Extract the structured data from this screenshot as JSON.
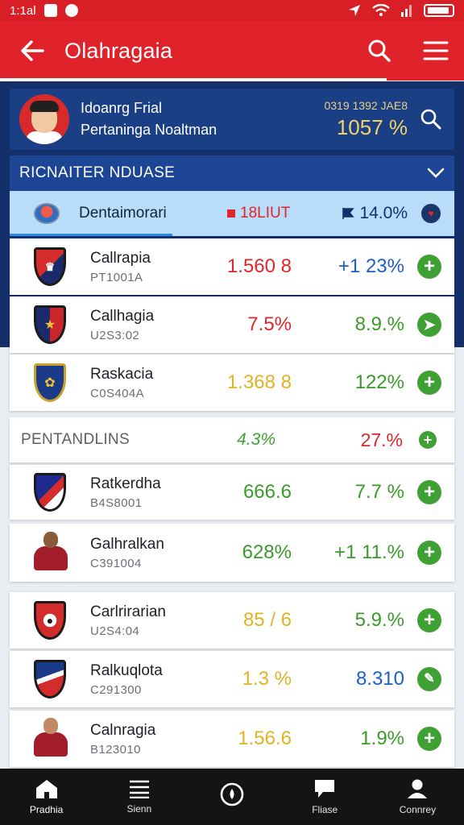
{
  "status_bar": {
    "time": "1:1al"
  },
  "app_bar": {
    "title": "Olahragaia"
  },
  "profile": {
    "name": "Idoanrg Frial",
    "subtitle": "Pertaninga Noaltman",
    "stat_label": "0319 1392 JAE8",
    "stat_value": "1057 %"
  },
  "section1": {
    "title": "RICNAITER NDUASE"
  },
  "highlight_row": {
    "label": "Dentaimorari",
    "value": "18LIUT",
    "percent": "14.0%"
  },
  "rows_top": [
    {
      "name": "Callrapia",
      "code": "PT1001A",
      "value": "1.560 8",
      "percent": "+1 23%",
      "value_color": "#e0262d",
      "percent_color": "#1f5fc4",
      "icon": "plus-icon"
    },
    {
      "name": "Callhagia",
      "code": "U2S3:02",
      "value": "7.5%",
      "percent": "8.9.%",
      "value_color": "#e0262d",
      "percent_color": "#3a9a2a",
      "icon": "arrow-icon"
    },
    {
      "name": "Raskacia",
      "code": "C0S404A",
      "value": "1.368 8",
      "percent": "122%",
      "value_color": "#dfb323",
      "percent_color": "#3a9a2a",
      "icon": "plus-icon"
    }
  ],
  "section2": {
    "title": "PENTANDLINS",
    "value": "4.3%",
    "percent": "27.%"
  },
  "rows_bottom": [
    {
      "name": "Ratkerdha",
      "code": "B4S8001",
      "value": "666.6",
      "percent": "7.7 %",
      "value_color": "#3a9a2a",
      "percent_color": "#3a9a2a",
      "icon": "plus-icon"
    },
    {
      "name": "Galhralkan",
      "code": "C391004",
      "value": "628%",
      "percent": "+1 11.%",
      "value_color": "#3a9a2a",
      "percent_color": "#3a9a2a",
      "icon": "plus-icon"
    },
    {
      "name": "Carlrirarian",
      "code": "U2S4:04",
      "value": "85 / 6",
      "percent": "5.9.%",
      "value_color": "#dfb323",
      "percent_color": "#3a9a2a",
      "icon": "plus-icon"
    },
    {
      "name": "Ralkuqlota",
      "code": "C291300",
      "value": "1.3 %",
      "percent": "8.310",
      "value_color": "#dfb323",
      "percent_color": "#1f5fc4",
      "icon": "arrow-icon"
    },
    {
      "name": "Calnragia",
      "code": "B123010",
      "value": "1.56.6",
      "percent": "1.9%",
      "value_color": "#dfb323",
      "percent_color": "#3a9a2a",
      "icon": "plus-icon"
    }
  ],
  "bottom_nav": [
    {
      "label": "Pradhia",
      "icon": "home-icon"
    },
    {
      "label": "Sienn",
      "icon": "list-icon"
    },
    {
      "label": "",
      "icon": "circle-icon"
    },
    {
      "label": "Fliase",
      "icon": "chat-icon"
    },
    {
      "label": "Connrey",
      "icon": "user-icon"
    }
  ],
  "colors": {
    "brand_red": "#e0232a",
    "navy": "#13306b",
    "accent_green": "#3fa033",
    "highlight_blue": "#b9dcf8"
  }
}
